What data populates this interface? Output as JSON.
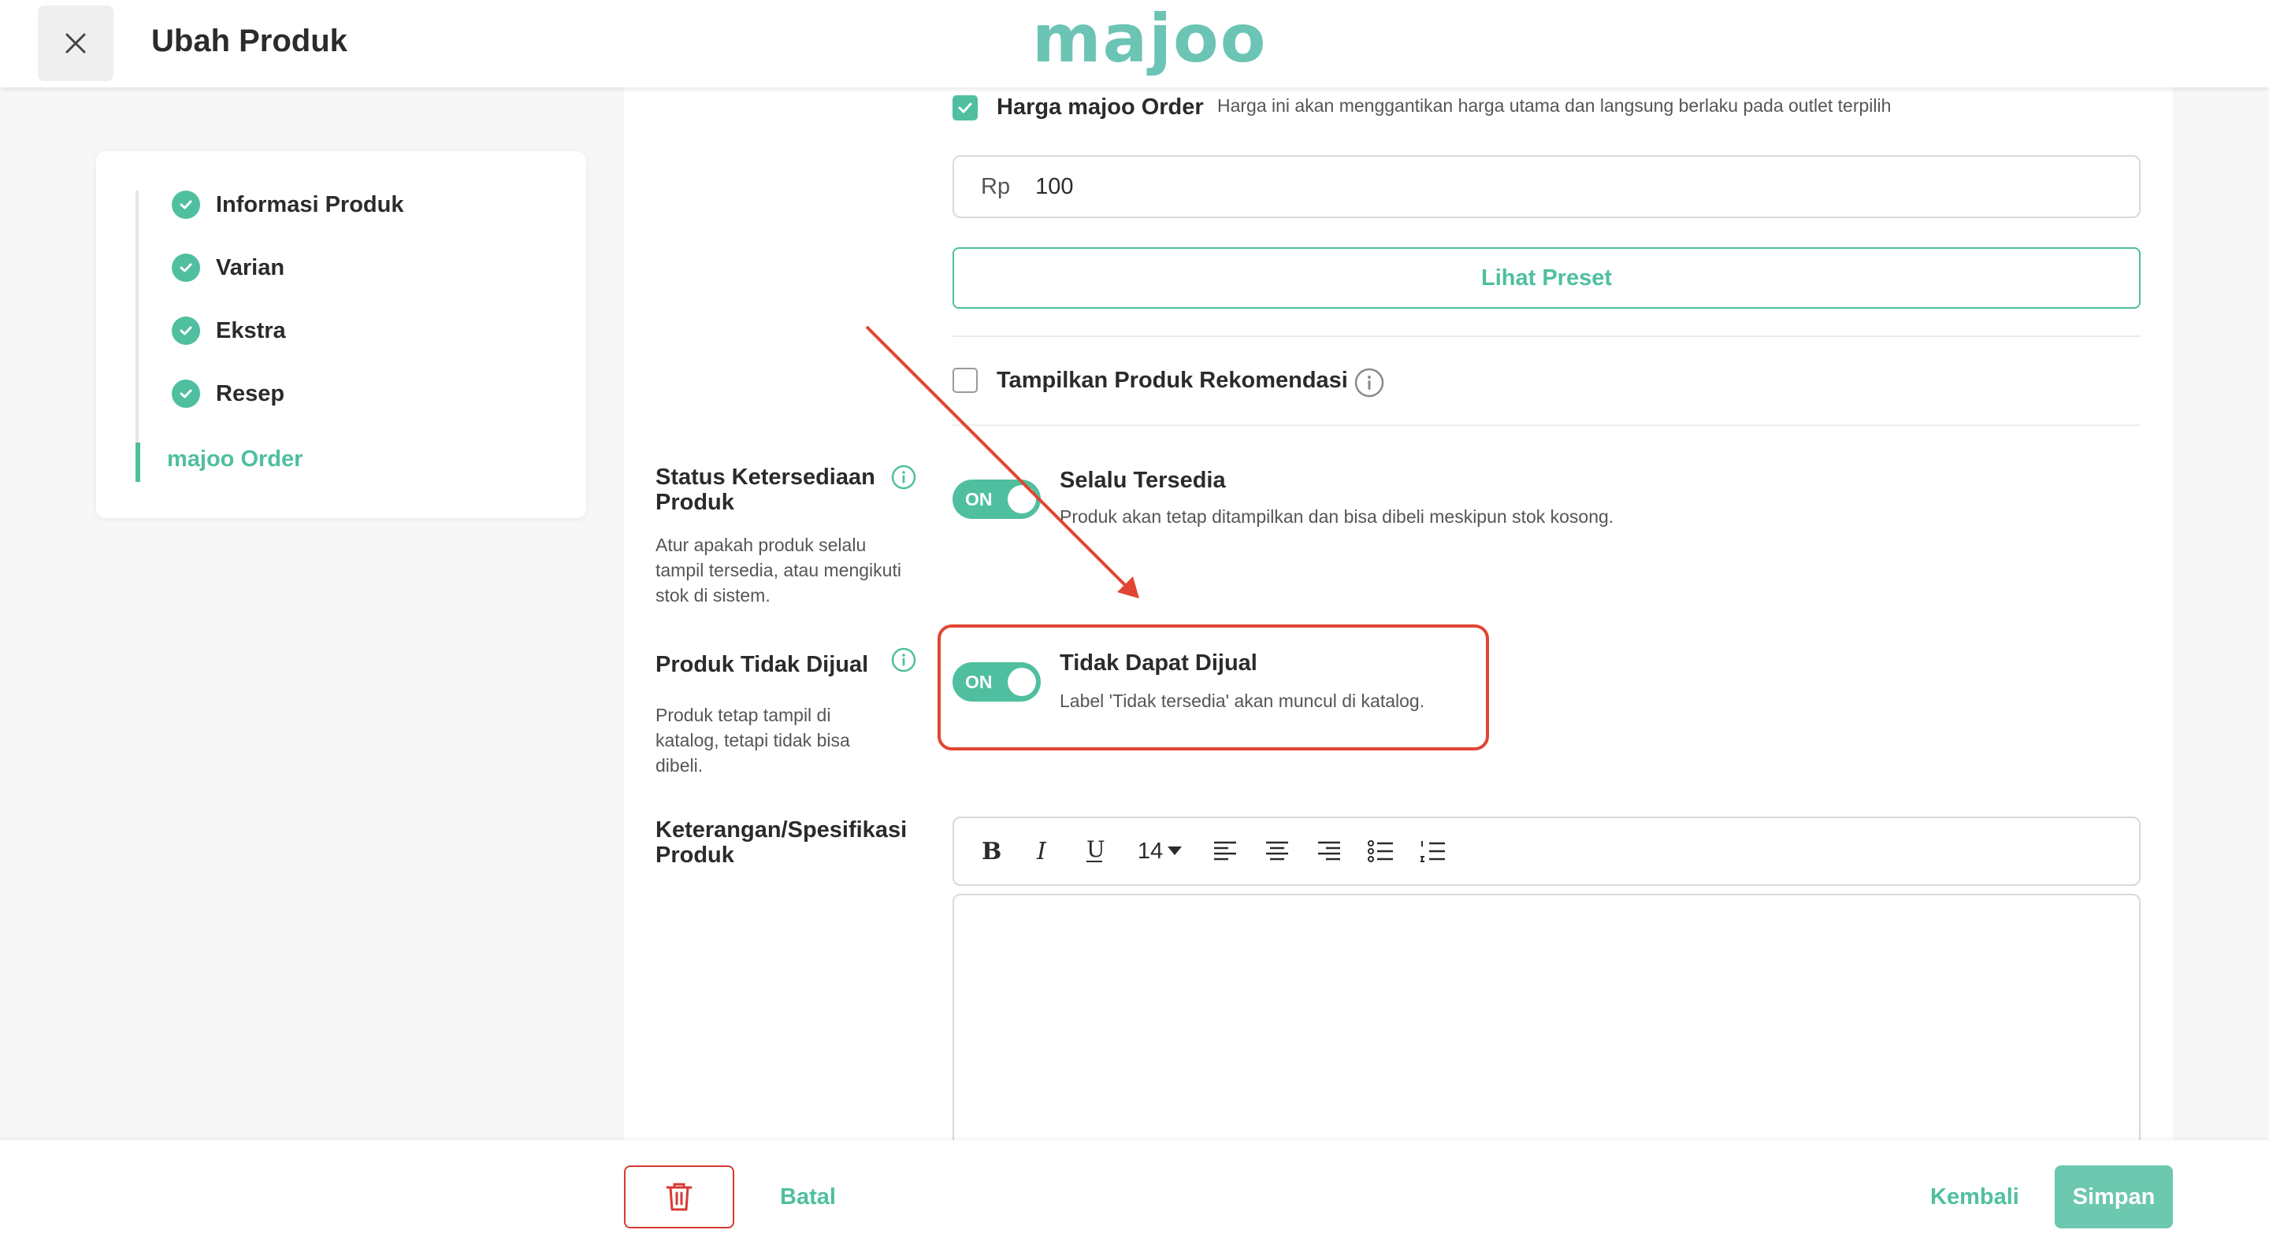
{
  "header": {
    "title": "Ubah Produk",
    "logo_text": "majoo"
  },
  "steps": [
    {
      "label": "Informasi Produk",
      "done": true
    },
    {
      "label": "Varian",
      "done": true
    },
    {
      "label": "Ekstra",
      "done": true
    },
    {
      "label": "Resep",
      "done": true
    },
    {
      "label": "majoo Order",
      "active": true
    }
  ],
  "order_price": {
    "checkbox_label": "Harga majoo Order",
    "note": "Harga ini akan menggantikan harga utama dan langsung berlaku pada outlet terpilih",
    "currency_prefix": "Rp",
    "value": "100",
    "preset_button": "Lihat Preset"
  },
  "recommendation": {
    "label": "Tampilkan Produk Rekomendasi"
  },
  "availability": {
    "title": "Status Ketersediaan Produk",
    "description": "Atur apakah produk selalu tampil tersedia, atau mengikuti stok di sistem.",
    "toggle_label": "ON",
    "option_title": "Selalu Tersedia",
    "option_desc": "Produk akan tetap ditampilkan dan bisa dibeli meskipun stok kosong."
  },
  "not_for_sale": {
    "title": "Produk Tidak Dijual",
    "description": "Produk tetap tampil di katalog, tetapi tidak bisa dibeli.",
    "toggle_label": "ON",
    "option_title": "Tidak Dapat Dijual",
    "option_desc": "Label 'Tidak tersedia' akan muncul di katalog."
  },
  "specification": {
    "title": "Keterangan/Spesifikasi Produk",
    "font_size": "14"
  },
  "footer": {
    "cancel": "Batal",
    "back": "Kembali",
    "save": "Simpan"
  },
  "colors": {
    "accent": "#4fbf9f",
    "danger": "#d83a34",
    "annotation": "#e24632"
  }
}
